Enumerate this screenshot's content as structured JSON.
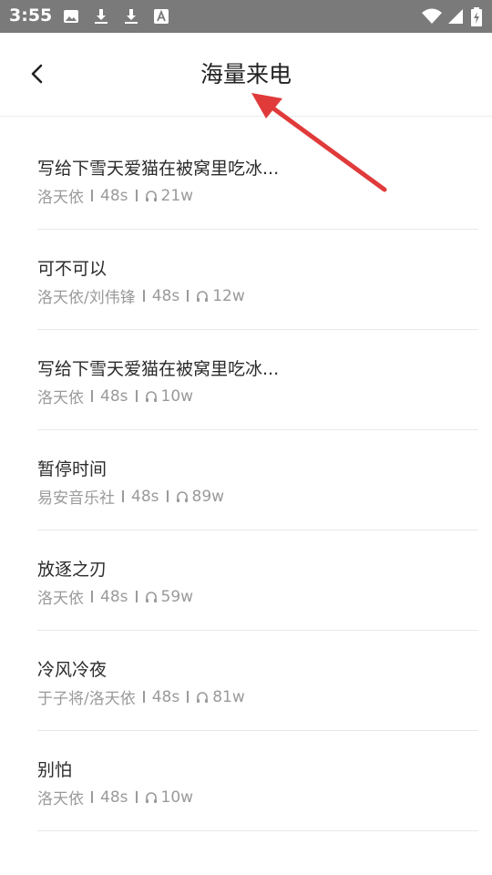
{
  "status_bar": {
    "time": "3:55",
    "left_icons": [
      "image-icon",
      "download-icon",
      "download-icon",
      "font-icon"
    ],
    "right_icons": [
      "wifi-icon",
      "signal-icon",
      "battery-icon"
    ]
  },
  "header": {
    "title": "海量来电",
    "back_icon": "chevron-left-icon"
  },
  "list": [
    {
      "title": "写给下雪天爱猫在被窝里吃冰...",
      "artist": "洛天依",
      "duration": "48s",
      "plays": "21w"
    },
    {
      "title": "可不可以",
      "artist": "洛天依/刘伟锋",
      "duration": "48s",
      "plays": "12w"
    },
    {
      "title": "写给下雪天爱猫在被窝里吃冰...",
      "artist": "洛天依",
      "duration": "48s",
      "plays": "10w"
    },
    {
      "title": "暂停时间",
      "artist": "易安音乐社",
      "duration": "48s",
      "plays": "89w"
    },
    {
      "title": "放逐之刃",
      "artist": "洛天依",
      "duration": "48s",
      "plays": "59w"
    },
    {
      "title": "冷风冷夜",
      "artist": "于子将/洛天依",
      "duration": "48s",
      "plays": "81w"
    },
    {
      "title": "别怕",
      "artist": "洛天依",
      "duration": "48s",
      "plays": "10w"
    },
    {
      "title": "",
      "artist": "",
      "duration": "",
      "plays": ""
    }
  ],
  "colors": {
    "status_bar_bg": "#7a7a7a",
    "annotation_arrow": "#e03a3a",
    "text_primary": "#2b2b2b",
    "text_secondary": "#9a9a9a"
  }
}
